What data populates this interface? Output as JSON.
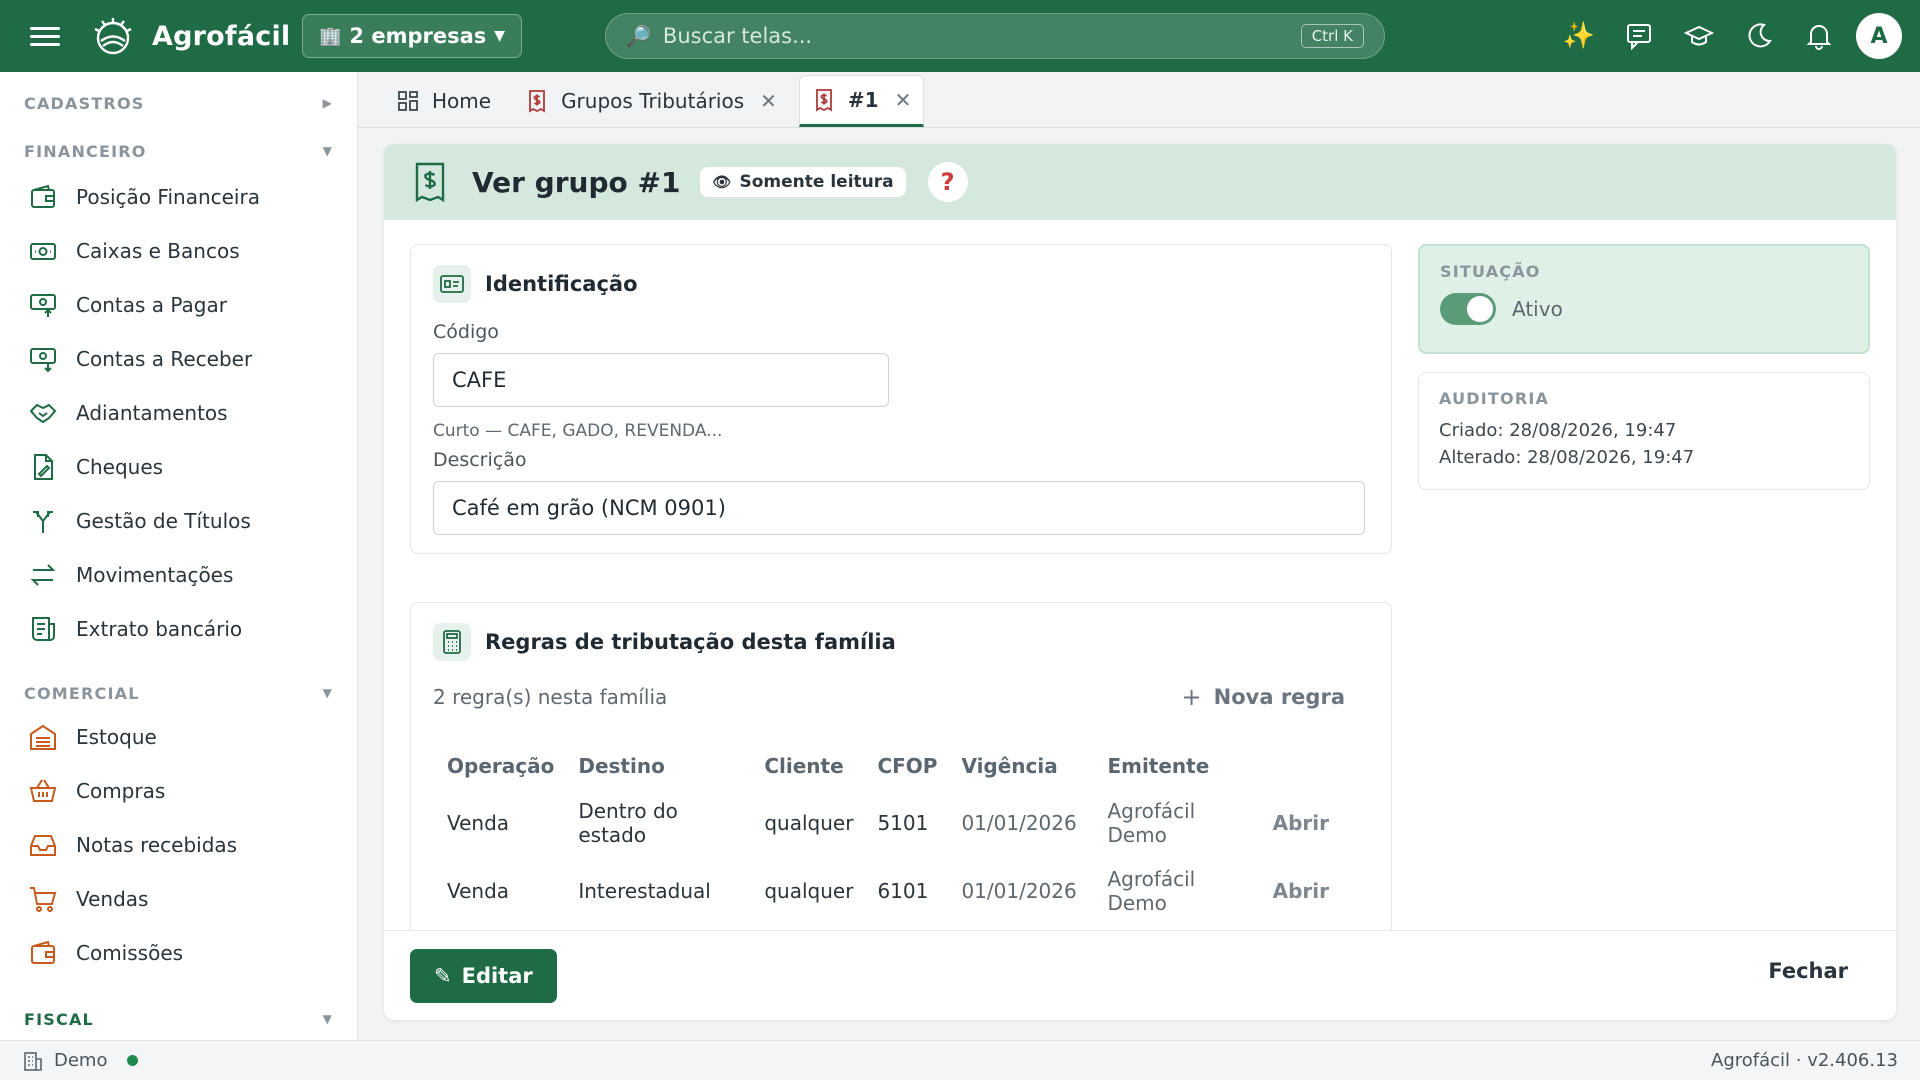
{
  "topbar": {
    "brand": "Agrofácil",
    "company_selector": "2 empresas",
    "search_placeholder": "Buscar telas...",
    "search_shortcut": "Ctrl K",
    "avatar_initial": "A"
  },
  "sidebar": {
    "sections": [
      {
        "label": "CADASTROS",
        "state": "collapsed"
      },
      {
        "label": "FINANCEIRO",
        "state": "expanded",
        "items": [
          {
            "label": "Posição Financeira",
            "icon": "wallet-icon"
          },
          {
            "label": "Caixas e Bancos",
            "icon": "cash-icon"
          },
          {
            "label": "Contas a Pagar",
            "icon": "cash-out-icon"
          },
          {
            "label": "Contas a Receber",
            "icon": "cash-in-icon"
          },
          {
            "label": "Adiantamentos",
            "icon": "handshake-icon"
          },
          {
            "label": "Cheques",
            "icon": "check-icon"
          },
          {
            "label": "Gestão de Títulos",
            "icon": "split-icon"
          },
          {
            "label": "Movimentações",
            "icon": "transfer-icon"
          },
          {
            "label": "Extrato bancário",
            "icon": "receipt-icon"
          }
        ]
      },
      {
        "label": "COMERCIAL",
        "state": "expanded",
        "items": [
          {
            "label": "Estoque",
            "icon": "warehouse-icon"
          },
          {
            "label": "Compras",
            "icon": "basket-icon"
          },
          {
            "label": "Notas recebidas",
            "icon": "inbox-icon"
          },
          {
            "label": "Vendas",
            "icon": "cart-icon"
          },
          {
            "label": "Comissões",
            "icon": "wallet-icon"
          }
        ]
      },
      {
        "label": "FISCAL",
        "state": "expanded"
      }
    ]
  },
  "tabs": [
    {
      "label": "Home",
      "icon": "grid-icon",
      "closable": false
    },
    {
      "label": "Grupos Tributários",
      "icon": "dollar-doc-icon",
      "closable": true
    },
    {
      "label": "#1",
      "icon": "dollar-doc-icon",
      "closable": true,
      "active": true
    }
  ],
  "page": {
    "title": "Ver grupo #1",
    "readonly_badge": "Somente leitura",
    "help": "?"
  },
  "identification": {
    "title": "Identificação",
    "code_label": "Código",
    "code_value": "CAFE",
    "code_hint": "Curto — CAFE, GADO, REVENDA...",
    "description_label": "Descrição",
    "description_value": "Café em grão (NCM 0901)"
  },
  "status": {
    "heading": "SITUAÇÃO",
    "label": "Ativo",
    "active": true
  },
  "audit": {
    "heading": "AUDITORIA",
    "created": "Criado: 28/08/2026, 19:47",
    "modified": "Alterado: 28/08/2026, 19:47"
  },
  "rules": {
    "title": "Regras de tributação desta família",
    "count_text": "2 regra(s) nesta família",
    "new_rule_label": "Nova regra",
    "columns": [
      "Operação",
      "Destino",
      "Cliente",
      "CFOP",
      "Vigência",
      "Emitente"
    ],
    "rows": [
      {
        "operacao": "Venda",
        "destino": "Dentro do estado",
        "cliente": "qualquer",
        "cfop": "5101",
        "vigencia": "01/01/2026",
        "emitente": "Agrofácil Demo",
        "action": "Abrir"
      },
      {
        "operacao": "Venda",
        "destino": "Interestadual",
        "cliente": "qualquer",
        "cfop": "6101",
        "vigencia": "01/01/2026",
        "emitente": "Agrofácil Demo",
        "action": "Abrir"
      }
    ]
  },
  "actions": {
    "edit_label": "Editar",
    "close_label": "Fechar"
  },
  "footer": {
    "environment": "Demo",
    "version": "Agrofácil · v2.406.13"
  },
  "colors": {
    "brand_green": "#1f6b45",
    "header_tint": "#d4e8dd",
    "status_tint": "#dff0e6",
    "section_accent": "#c75a1d"
  }
}
